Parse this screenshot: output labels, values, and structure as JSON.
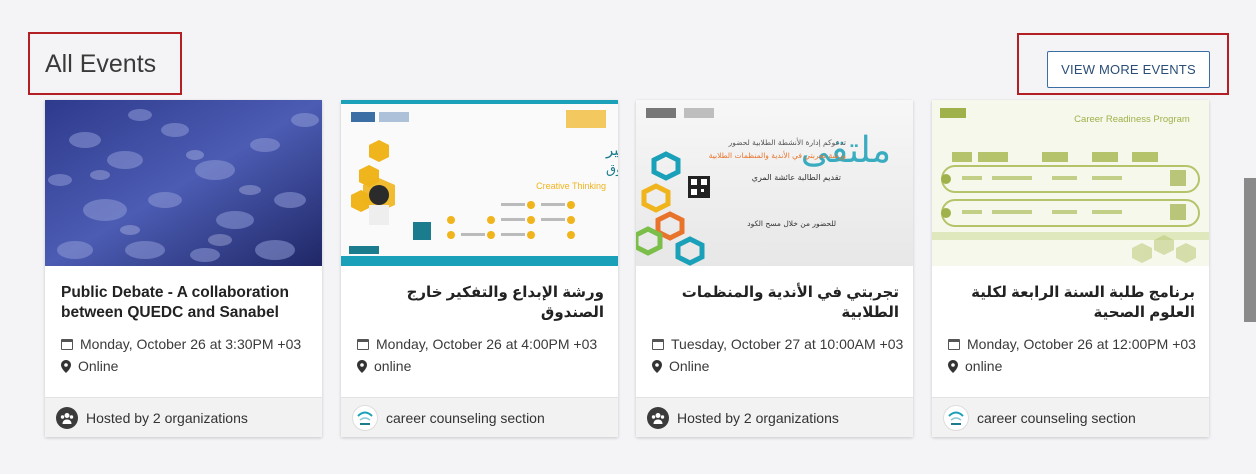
{
  "section": {
    "title": "All Events"
  },
  "actions": {
    "view_more": "VIEW MORE EVENTS"
  },
  "events": [
    {
      "title": "Public Debate - A collaboration between QUEDC and Sanabel",
      "date": "Monday, October 26 at 3:30PM +03",
      "location": "Online",
      "host": "Hosted by 2 organizations"
    },
    {
      "title": "ورشة الإبداع والتفكير خارج الصندوق",
      "date": "Monday, October 26 at 4:00PM +03",
      "location": "online",
      "host": "career counseling section",
      "image_text": {
        "title": "الإبداع والتفكير",
        "subtitle": "خارج الصندوق",
        "tagline": "Creative Thinking"
      }
    },
    {
      "title": "تجربتي في الأندية والمنظمات الطلابية",
      "date": "Tuesday, October 27 at 10:00AM +03",
      "location": "Online",
      "host": "Hosted by 2 organizations",
      "image_text": {
        "line1": "تدعوكم إدارة الأنشطة الطلابية لحضور",
        "line2": "ورشة تجربتي في الأندية والمنظمات الطلابية",
        "line3": "تقديم الطالبة عائشة المري",
        "line4": "للحضور من خلال مسح الكود"
      }
    },
    {
      "title": "برنامج طلبة السنة الرابعة لكلية العلوم الصحية",
      "date": "Monday, October 26 at 12:00PM +03",
      "location": "online",
      "host": "career counseling section",
      "image_text": {
        "title": "Career Readiness Program"
      }
    }
  ],
  "colors": {
    "accent": "#2b4e78",
    "annotation": "#b41f24",
    "gold": "#f0b41c",
    "teal": "#1aa0b8",
    "olive": "#b5c46a"
  }
}
